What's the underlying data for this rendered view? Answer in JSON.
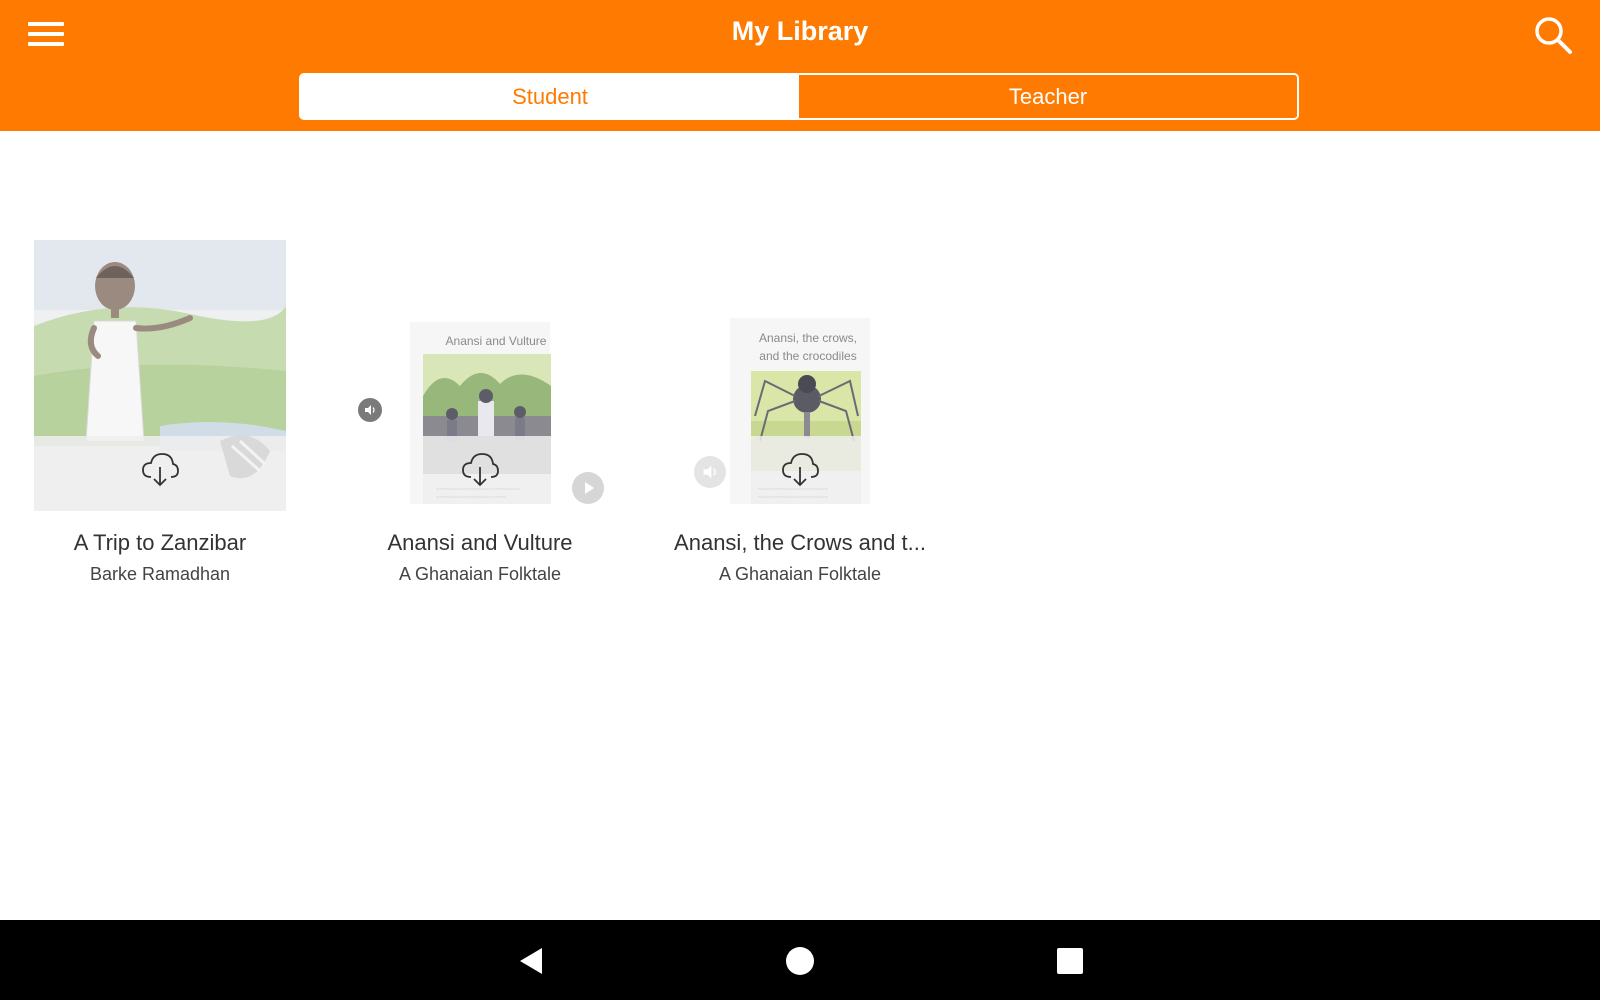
{
  "header": {
    "title": "My Library",
    "menu_icon": "hamburger-menu-icon",
    "search_icon": "search-icon",
    "accent_color": "#FF7A00"
  },
  "tabs": [
    {
      "label": "Student",
      "active": true
    },
    {
      "label": "Teacher",
      "active": false
    }
  ],
  "books": [
    {
      "title": "A Trip to Zanzibar",
      "author": "Barke Ramadhan",
      "status_icon": "cloud-download-icon"
    },
    {
      "title": "Anansi and Vulture",
      "author": "A Ghanaian Folktale",
      "cover_title": "Anansi and Vulture",
      "status_icon": "cloud-download-icon",
      "audio_icon": "speaker-icon",
      "play_icon": "play-icon"
    },
    {
      "title": "Anansi, the Crows and t...",
      "author": "A Ghanaian Folktale",
      "cover_title_lines": [
        "Anansi, the crows,",
        "and the crocodiles"
      ],
      "status_icon": "cloud-download-icon",
      "audio_icon": "speaker-icon"
    }
  ],
  "system_nav": {
    "back_icon": "back-triangle-icon",
    "home_icon": "home-circle-icon",
    "recents_icon": "recents-square-icon"
  }
}
